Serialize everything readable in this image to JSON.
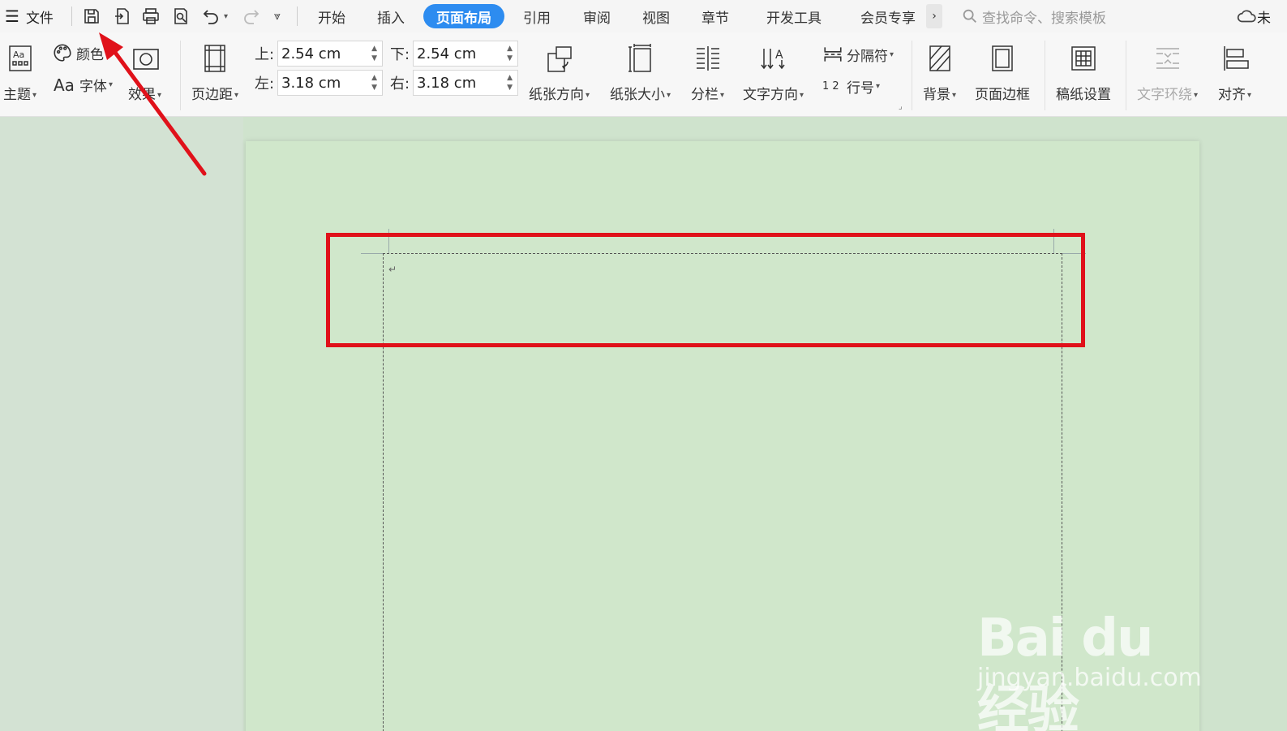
{
  "menubar": {
    "menu_label": "文件",
    "tabs": [
      {
        "label": "开始"
      },
      {
        "label": "插入"
      },
      {
        "label": "页面布局",
        "active": true
      },
      {
        "label": "引用"
      },
      {
        "label": "审阅"
      },
      {
        "label": "视图"
      },
      {
        "label": "章节"
      },
      {
        "label": "开发工具"
      },
      {
        "label": "会员专享"
      }
    ],
    "more_label": "›",
    "search_placeholder": "查找命令、搜索模板",
    "cloud_label": "未"
  },
  "ribbon": {
    "theme": {
      "label": "主题",
      "icon_text": "Aa"
    },
    "colors": {
      "label": "颜色"
    },
    "fonts": {
      "label": "字体",
      "icon_text": "Aa"
    },
    "effects": {
      "label": "效果"
    },
    "margins": {
      "label": "页边距"
    },
    "margin_top": {
      "label": "上:",
      "value": "2.54 cm"
    },
    "margin_bottom": {
      "label": "下:",
      "value": "2.54 cm"
    },
    "margin_left": {
      "label": "左:",
      "value": "3.18 cm"
    },
    "margin_right": {
      "label": "右:",
      "value": "3.18 cm"
    },
    "orientation": {
      "label": "纸张方向"
    },
    "paper_size": {
      "label": "纸张大小"
    },
    "columns": {
      "label": "分栏"
    },
    "text_direction": {
      "label": "文字方向"
    },
    "separator": {
      "label": "分隔符"
    },
    "line_number": {
      "label": "行号",
      "icon_text": "1 2"
    },
    "background": {
      "label": "背景"
    },
    "page_border": {
      "label": "页面边框"
    },
    "manuscript": {
      "label": "稿纸设置"
    },
    "text_wrap": {
      "label": "文字环绕"
    },
    "align": {
      "label": "对齐"
    }
  },
  "document": {
    "paragraph_mark": "↵"
  },
  "watermark": {
    "logo": "Bai du 经验",
    "url": "jingyan.baidu.com"
  },
  "colors": {
    "accent": "#2d8cf0",
    "annotation_red": "#e0111a",
    "page_bg": "#d0e7cb"
  }
}
